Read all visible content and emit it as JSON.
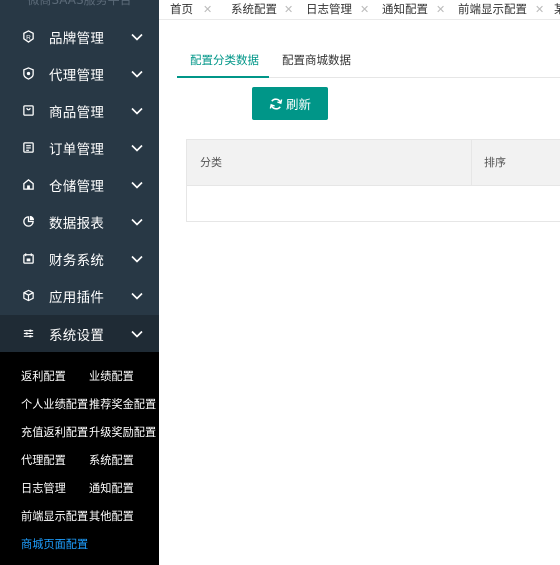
{
  "app": {
    "title": "微商SAAS服务平台"
  },
  "sidebar": {
    "items": [
      {
        "label": "品牌管理",
        "icon": "brand-icon"
      },
      {
        "label": "代理管理",
        "icon": "agent-icon"
      },
      {
        "label": "商品管理",
        "icon": "product-icon"
      },
      {
        "label": "订单管理",
        "icon": "order-icon"
      },
      {
        "label": "仓储管理",
        "icon": "warehouse-icon"
      },
      {
        "label": "数据报表",
        "icon": "report-icon"
      },
      {
        "label": "财务系统",
        "icon": "finance-icon"
      },
      {
        "label": "应用插件",
        "icon": "plugin-icon"
      },
      {
        "label": "系统设置",
        "icon": "settings-icon"
      }
    ],
    "submenu": [
      "返利配置",
      "业绩配置",
      "个人业绩配置",
      "推荐奖金配置",
      "充值返利配置",
      "升级奖励配置",
      "代理配置",
      "系统配置",
      "日志管理",
      "通知配置",
      "前端显示配置",
      "其他配置",
      "商城页面配置"
    ],
    "active_submenu": "商城页面配置"
  },
  "tabs": [
    "首页",
    "系统配置",
    "日志管理",
    "通知配置",
    "前端显示配置",
    "某"
  ],
  "content": {
    "sub_tabs": [
      "配置分类数据",
      "配置商城数据"
    ],
    "active_sub_tab": "配置分类数据",
    "refresh_label": "刷新",
    "table": {
      "headers": [
        "分类",
        "排序"
      ],
      "rows": []
    }
  },
  "colors": {
    "sidebar_bg": "#283845",
    "submenu_bg": "#000000",
    "accent": "#009688",
    "active_link": "#1e9fff"
  }
}
